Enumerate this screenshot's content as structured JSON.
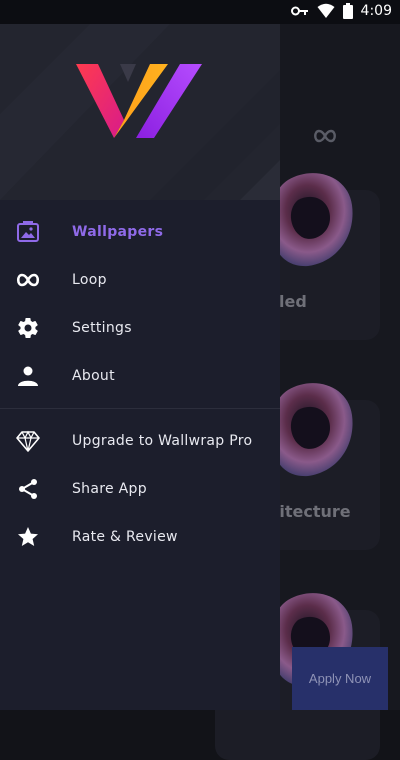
{
  "status_bar": {
    "time": "4:09",
    "icons": [
      "key-icon",
      "wifi-icon",
      "battery-icon"
    ]
  },
  "background": {
    "cards": [
      {
        "label": "oled"
      },
      {
        "label": "hitecture"
      }
    ],
    "apply_button": "Apply Now"
  },
  "drawer": {
    "logo": "wallwrap-logo",
    "primary_items": [
      {
        "label": "Wallpapers",
        "icon": "wallpaper-icon",
        "active": true
      },
      {
        "label": "Loop",
        "icon": "infinity-icon",
        "active": false
      },
      {
        "label": "Settings",
        "icon": "gear-icon",
        "active": false
      },
      {
        "label": "About",
        "icon": "person-icon",
        "active": false
      }
    ],
    "secondary_items": [
      {
        "label": "Upgrade to Wallwrap Pro",
        "icon": "diamond-icon"
      },
      {
        "label": "Share App",
        "icon": "share-icon"
      },
      {
        "label": "Rate & Review",
        "icon": "star-icon"
      }
    ]
  },
  "colors": {
    "accent": "#8f6ae8",
    "drawer_bg": "#1c1e2c",
    "header_bg": "#23252f"
  }
}
